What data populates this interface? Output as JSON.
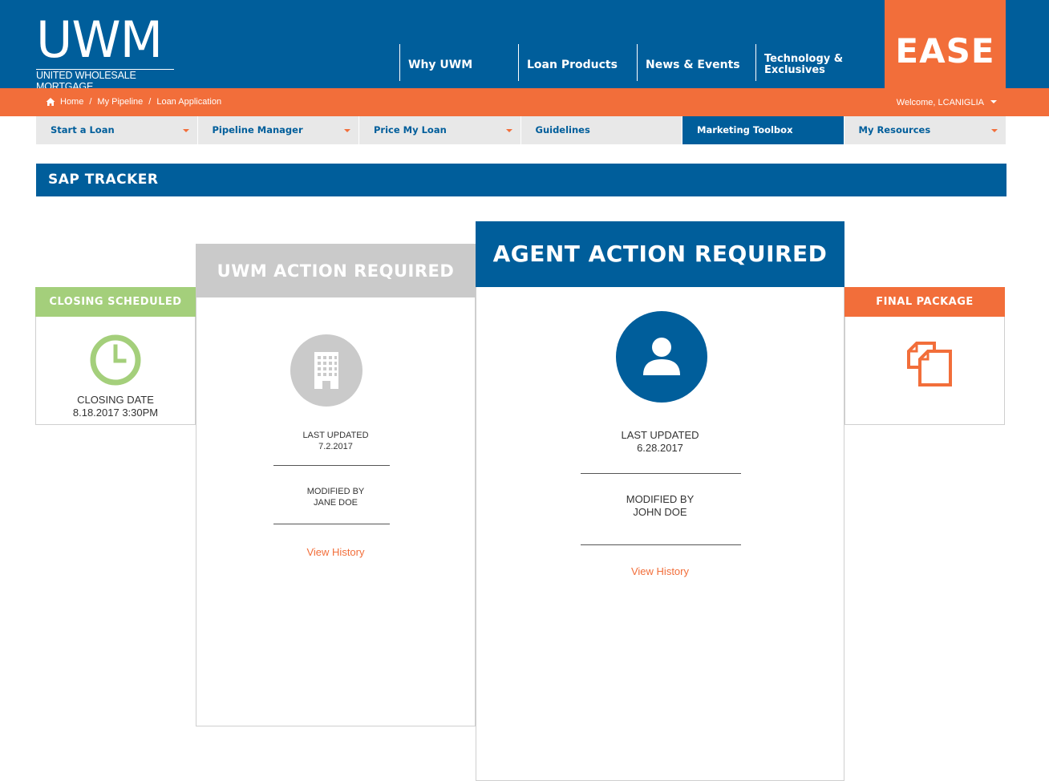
{
  "brand": {
    "logo_mark": "UWM",
    "logo_text": "UNITED WHOLESALE MORTGAGE",
    "ease_label": "EASE"
  },
  "main_nav": {
    "items": [
      {
        "label": "Why UWM"
      },
      {
        "label": "Loan Products"
      },
      {
        "label": "News & Events"
      },
      {
        "label": "Technology & Exclusives"
      }
    ]
  },
  "breadcrumb": {
    "items": [
      "Home",
      "My Pipeline",
      "Loan Application"
    ],
    "separator": "/"
  },
  "user": {
    "welcome": "Welcome, LCANIGLIA"
  },
  "sub_nav": {
    "items": [
      {
        "label": "Start a Loan",
        "has_dropdown": true
      },
      {
        "label": "Pipeline Manager",
        "has_dropdown": true
      },
      {
        "label": "Price My Loan",
        "has_dropdown": true
      },
      {
        "label": "Guidelines",
        "has_dropdown": false
      },
      {
        "label": "Marketing Toolbox",
        "has_dropdown": false,
        "active": true
      },
      {
        "label": "My Resources",
        "has_dropdown": true
      }
    ]
  },
  "section": {
    "title": "SAP TRACKER"
  },
  "cards": {
    "closing": {
      "title": "CLOSING SCHEDULED",
      "icon": "clock-icon",
      "label": "CLOSING DATE",
      "value": "8.18.2017 3:30PM",
      "color": "#a4cf7b"
    },
    "uwm": {
      "title": "UWM ACTION REQUIRED",
      "icon": "building-icon",
      "updated_label": "LAST UPDATED",
      "updated_value": "7.2.2017",
      "modified_label": "MODIFIED BY",
      "modified_value": "JANE DOE",
      "history_link": "View History",
      "color": "#cacaca"
    },
    "agent": {
      "title": "AGENT ACTION REQUIRED",
      "icon": "user-icon",
      "updated_label": "LAST UPDATED",
      "updated_value": "6.28.2017",
      "modified_label": "MODIFIED BY",
      "modified_value": "JOHN DOE",
      "history_link": "View History",
      "color": "#005e9b"
    },
    "final": {
      "title": "FINAL PACKAGE",
      "icon": "documents-icon",
      "color": "#f26e3a"
    }
  },
  "colors": {
    "primary_blue": "#005e9b",
    "accent_orange": "#f26e3a",
    "nav_gray": "#e8e8e8"
  }
}
